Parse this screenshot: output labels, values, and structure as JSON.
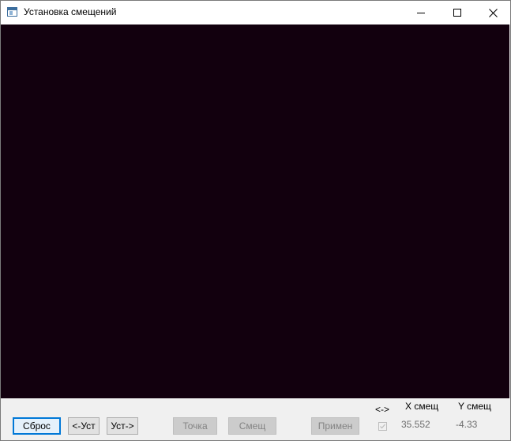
{
  "window": {
    "title": "Установка смещений",
    "controls": {
      "minimize_icon": "minimize-icon",
      "maximize_icon": "maximize-icon",
      "close_icon": "close-icon"
    }
  },
  "canvas": {
    "background": "#12000e"
  },
  "toolbar": {
    "reset_label": "Сброс",
    "set_left_label": "<-Уст",
    "set_right_label": "Уст->",
    "point_label": "Точка",
    "offset_label": "Смещ",
    "apply_label": "Примен"
  },
  "offsets": {
    "swap_label": "<->",
    "x_header": "X смещ",
    "y_header": "Y смещ",
    "x_value": "35.552",
    "y_value": "-4.33",
    "swap_checked": true
  },
  "colors": {
    "accent": "#0078d7",
    "disabled_text": "#838383"
  }
}
